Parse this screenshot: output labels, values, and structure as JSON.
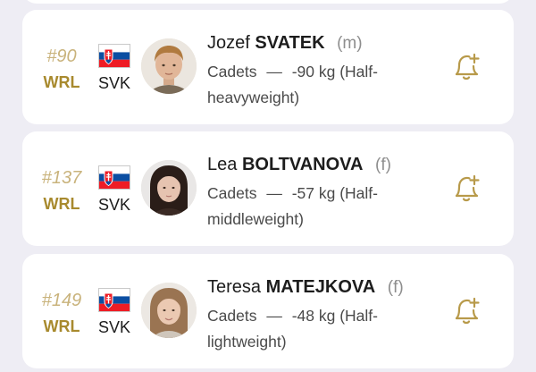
{
  "athletes": [
    {
      "rank": "#90",
      "rank_label": "WRL",
      "country": "SVK",
      "first_name": "Jozef",
      "last_name": "SVATEK",
      "gender": "(m)",
      "category": "Cadets",
      "separator": "—",
      "weight": "-90 kg (Half-heavyweight)"
    },
    {
      "rank": "#137",
      "rank_label": "WRL",
      "country": "SVK",
      "first_name": "Lea",
      "last_name": "BOLTVANOVA",
      "gender": "(f)",
      "category": "Cadets",
      "separator": "—",
      "weight": "-57 kg (Half-middleweight)"
    },
    {
      "rank": "#149",
      "rank_label": "WRL",
      "country": "SVK",
      "first_name": "Teresa",
      "last_name": "MATEJKOVA",
      "gender": "(f)",
      "category": "Cadets",
      "separator": "—",
      "weight": "-48 kg (Half-lightweight)"
    }
  ],
  "icons": {
    "flag": "slovakia-flag-icon",
    "avatar": "athlete-photo",
    "follow": "bell-plus-icon"
  },
  "colors": {
    "background": "#eeedf4",
    "card": "#ffffff",
    "rank_gold_light": "#c9b37c",
    "rank_gold": "#a88a2e",
    "bell_gold": "#b89a4a"
  }
}
